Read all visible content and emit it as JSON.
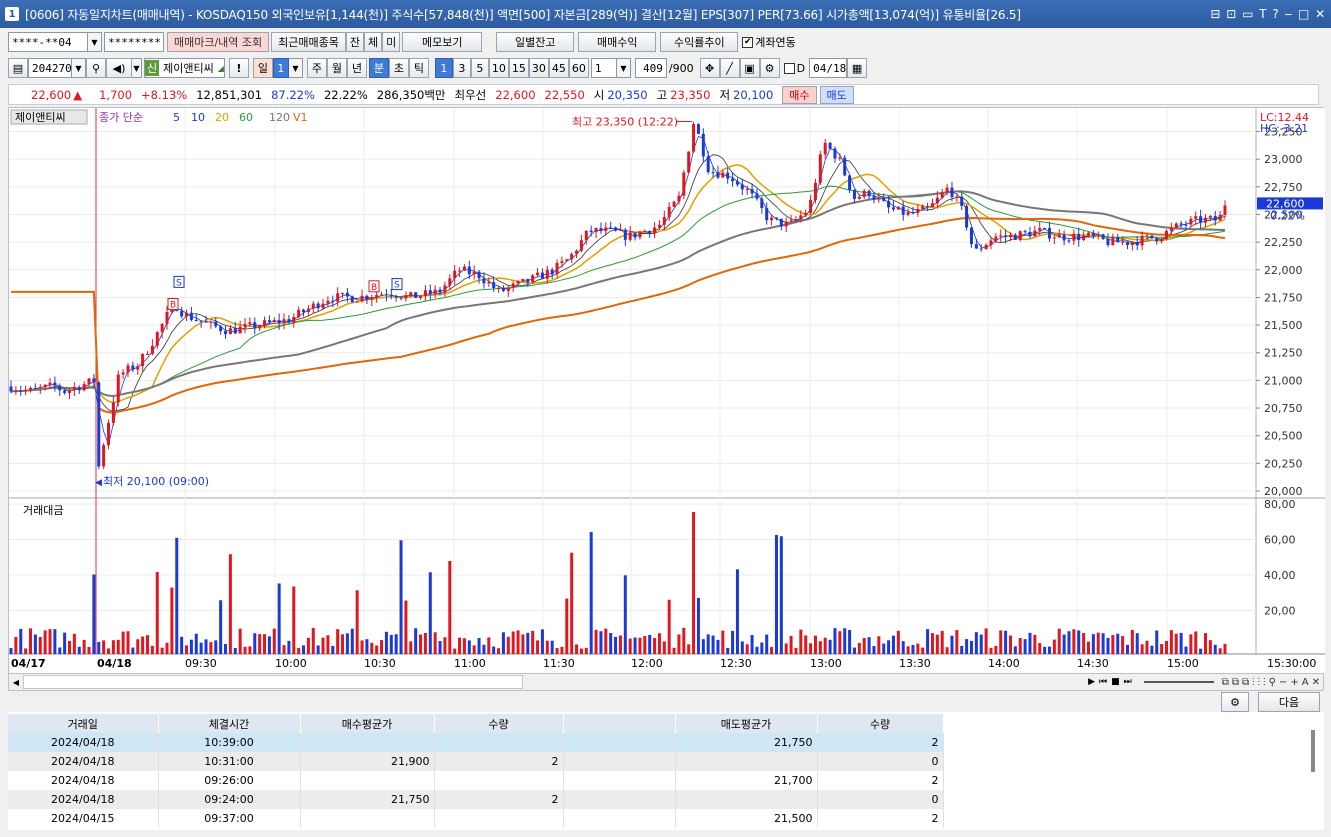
{
  "window": {
    "title": "[0606] 자동일지차트(매매내역) - KOSDAQ150 외국인보유[1,144(천)] 주식수[57,848(천)] 액면[500] 자본금[289(억)] 결산[12월] EPS[307] PER[73.66] 시가총액[13,074(억)] 유통비율[26.5]",
    "icon_label": "1",
    "controls": [
      "⊟",
      "⊡",
      "▭",
      "T",
      "?",
      "‒",
      "□",
      "✕"
    ]
  },
  "toolbar1": {
    "account": "****-**04",
    "password": "********",
    "btn_mark": "매매마크/내역 조회",
    "btn_recent": "최근매매종목",
    "btn_jan": "잔",
    "btn_che": "체",
    "btn_mi": "미",
    "btn_memo": "메모보기",
    "btn_daily": "일별잔고",
    "btn_profit": "매매수익",
    "btn_trend": "수익률추이",
    "link_label": "계좌연동",
    "link_checked": true
  },
  "toolbar2": {
    "code": "204270",
    "badge": "신",
    "stock_name": "제이앤티씨",
    "excl": "!",
    "day": "일",
    "day_num": "1",
    "week": "주",
    "month": "월",
    "year": "년",
    "min": "분",
    "sec": "초",
    "tick": "틱",
    "intervals": [
      "1",
      "3",
      "5",
      "10",
      "15",
      "30",
      "45",
      "60"
    ],
    "sel_interval": "1",
    "count": "1",
    "ratio": "409",
    "ratio_max": "/900",
    "d_label": "D",
    "date": "04/18"
  },
  "quote": {
    "price": "22,600",
    "arrow": "▲",
    "change": "1,700",
    "pct": "+8.13%",
    "volume": "12,851,301",
    "rate1": "87.22%",
    "rate2": "22.22%",
    "amount": "286,350백만",
    "label_prio": "최우선",
    "ask": "22,600",
    "bid": "22,550",
    "open_label": "시",
    "open": "20,350",
    "high_label": "고",
    "high": "23,350",
    "low_label": "저",
    "low": "20,100",
    "buy": "매수",
    "sell": "매도"
  },
  "chart": {
    "stock_tab": "제이앤티씨",
    "legend": [
      {
        "text": "종가 단순",
        "color": "#9b2fae"
      },
      {
        "text": "5",
        "color": "#1a39d8"
      },
      {
        "text": "10",
        "color": "#1a39d8"
      },
      {
        "text": "20",
        "color": "#e0a000"
      },
      {
        "text": "60",
        "color": "#2e9a3a"
      },
      {
        "text": "120",
        "color": "#777777"
      },
      {
        "text": "V1",
        "color": "#e0660a"
      }
    ],
    "lc": "LC:12.44",
    "hc": "HC:-3.21",
    "price_tag": "22,600",
    "pct_tag": "0.22%",
    "high_note": "최고 23,350 (12:22)",
    "low_note": "최저 20,100 (09:00)",
    "vol_title": "거래대금",
    "y_ticks": [
      "23,250",
      "23,000",
      "22,750",
      "22,500",
      "22,250",
      "22,000",
      "21,750",
      "21,500",
      "21,250",
      "21,000",
      "20,750",
      "20,500",
      "20,250",
      "20,000"
    ],
    "vol_ticks": [
      "80,00",
      "60,00",
      "40,00",
      "20,00"
    ],
    "x_ticks": [
      "04/17",
      "04/18",
      "09:30",
      "10:00",
      "10:30",
      "11:00",
      "11:30",
      "12:00",
      "12:30",
      "13:00",
      "13:30",
      "14:00",
      "14:30",
      "15:00",
      "15:30:00"
    ],
    "markers": [
      "S",
      "B",
      "B",
      "S"
    ]
  },
  "chart_data": {
    "type": "candlestick",
    "open": 20350,
    "high": 23350,
    "low": 20100,
    "last": 22600,
    "ylim": [
      20000,
      23300
    ],
    "y2lim": [
      0,
      80
    ]
  },
  "bottom": {
    "next": "다음",
    "headers": [
      "거래일",
      "체결시간",
      "매수평균가",
      "수량",
      "",
      "매도평균가",
      "수량"
    ],
    "rows": [
      [
        "2024/04/18",
        "10:39:00",
        "",
        "",
        "",
        "21,750",
        "2"
      ],
      [
        "2024/04/18",
        "10:31:00",
        "21,900",
        "2",
        "",
        "",
        "0"
      ],
      [
        "2024/04/18",
        "09:26:00",
        "",
        "",
        "",
        "21,700",
        "2"
      ],
      [
        "2024/04/18",
        "09:24:00",
        "21,750",
        "2",
        "",
        "",
        "0"
      ],
      [
        "2024/04/15",
        "09:37:00",
        "",
        "",
        "",
        "21,500",
        "2"
      ]
    ]
  }
}
